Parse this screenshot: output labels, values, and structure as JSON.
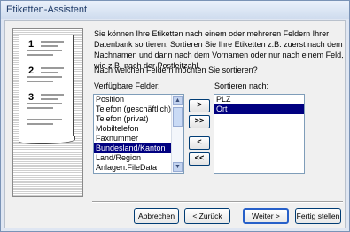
{
  "window": {
    "title": "Etiketten-Assistent"
  },
  "intro_text": "Sie können Ihre Etiketten nach einem oder mehreren Feldern Ihrer Datenbank sortieren. Sortieren Sie Ihre Etiketten z.B. zuerst nach dem Nachnamen und dann nach dem Vornamen oder nur nach einem Feld, wie z.B. nach der Postleitzahl.",
  "question": "Nach welchen Feldern möchten Sie sortieren?",
  "illustration": {
    "numbers": [
      "1",
      "2",
      "3"
    ]
  },
  "available_fields": {
    "label": "Verfügbare Felder:",
    "items": [
      "Position",
      "Telefon (geschäftlich)",
      "Telefon (privat)",
      "Mobiltelefon",
      "Faxnummer",
      "Bundesland/Kanton",
      "Land/Region",
      "Anlagen.FileData"
    ],
    "selected": "Bundesland/Kanton"
  },
  "sort_by": {
    "label": "Sortieren nach:",
    "items": [
      "PLZ",
      "Ort"
    ],
    "selected": "Ort"
  },
  "move_buttons": {
    "add_one": ">",
    "add_all": ">>",
    "remove_one": "<",
    "remove_all": "<<"
  },
  "buttons": {
    "cancel": "Abbrechen",
    "back": "< Zurück",
    "next": "Weiter >",
    "finish": "Fertig stellen"
  }
}
